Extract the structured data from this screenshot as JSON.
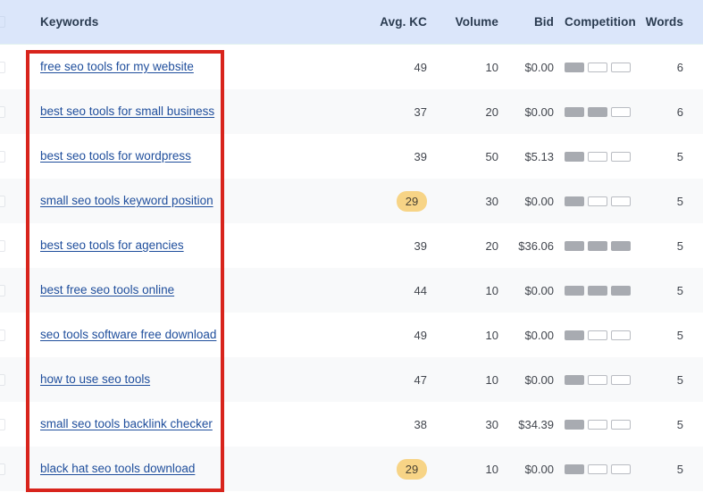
{
  "table": {
    "columns": [
      {
        "key": "keyword",
        "label": "Keywords"
      },
      {
        "key": "kc",
        "label": "Avg. KC"
      },
      {
        "key": "volume",
        "label": "Volume"
      },
      {
        "key": "bid",
        "label": "Bid"
      },
      {
        "key": "competition",
        "label": "Competition"
      },
      {
        "key": "words",
        "label": "Words"
      }
    ],
    "rows": [
      {
        "keyword": "free seo tools for my website",
        "kc": "49",
        "kc_highlight": false,
        "volume": "10",
        "bid": "$0.00",
        "competition_filled": 1,
        "competition_total": 3,
        "words": "6"
      },
      {
        "keyword": "best seo tools for small business",
        "kc": "37",
        "kc_highlight": false,
        "volume": "20",
        "bid": "$0.00",
        "competition_filled": 2,
        "competition_total": 3,
        "words": "6"
      },
      {
        "keyword": "best seo tools for wordpress",
        "kc": "39",
        "kc_highlight": false,
        "volume": "50",
        "bid": "$5.13",
        "competition_filled": 1,
        "competition_total": 3,
        "words": "5"
      },
      {
        "keyword": "small seo tools keyword position",
        "kc": "29",
        "kc_highlight": true,
        "volume": "30",
        "bid": "$0.00",
        "competition_filled": 1,
        "competition_total": 3,
        "words": "5"
      },
      {
        "keyword": "best seo tools for agencies",
        "kc": "39",
        "kc_highlight": false,
        "volume": "20",
        "bid": "$36.06",
        "competition_filled": 3,
        "competition_total": 3,
        "words": "5"
      },
      {
        "keyword": "best free seo tools online",
        "kc": "44",
        "kc_highlight": false,
        "volume": "10",
        "bid": "$0.00",
        "competition_filled": 3,
        "competition_total": 3,
        "words": "5"
      },
      {
        "keyword": "seo tools software free download",
        "kc": "49",
        "kc_highlight": false,
        "volume": "10",
        "bid": "$0.00",
        "competition_filled": 1,
        "competition_total": 3,
        "words": "5"
      },
      {
        "keyword": "how to use seo tools",
        "kc": "47",
        "kc_highlight": false,
        "volume": "10",
        "bid": "$0.00",
        "competition_filled": 1,
        "competition_total": 3,
        "words": "5"
      },
      {
        "keyword": "small seo tools backlink checker",
        "kc": "38",
        "kc_highlight": false,
        "volume": "30",
        "bid": "$34.39",
        "competition_filled": 1,
        "competition_total": 3,
        "words": "5"
      },
      {
        "keyword": "black hat seo tools download",
        "kc": "29",
        "kc_highlight": true,
        "volume": "10",
        "bid": "$0.00",
        "competition_filled": 1,
        "competition_total": 3,
        "words": "5"
      }
    ]
  },
  "annotation": {
    "type": "rectangle-highlight",
    "color": "#d8241c",
    "target": "keywords-column"
  },
  "colors": {
    "header_background": "#dbe6fa",
    "header_text": "#2a3b50",
    "link": "#1f4e9c",
    "row_alt_background": "#f8f9fa",
    "kc_badge_background": "#f7d486",
    "competition_filled": "#a8abb1",
    "annotation": "#d8241c"
  }
}
